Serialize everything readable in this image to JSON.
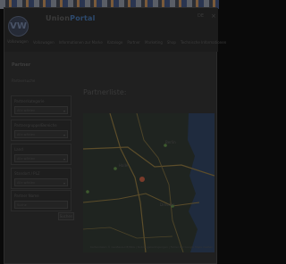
{
  "header": {
    "logo_text": "VW",
    "logo_label": "Volkswagen",
    "portal_name_a": "Union",
    "portal_name_b": "Portal",
    "language": "DE",
    "close_icon": "×"
  },
  "nav": {
    "items": [
      "Volkswagen",
      "Informationen zur Marke",
      "Kataloge",
      "Partner",
      "Marketing",
      "Shop",
      "Technische Informationen"
    ]
  },
  "sidebar": {
    "title": "Partner",
    "subtitle": "Partnersuche",
    "filters": [
      {
        "label": "Partnerkategorie",
        "value": "Alle wählen"
      },
      {
        "label": "Partnergruppe/Bereiche",
        "value": "Alle wählen"
      },
      {
        "label": "Land",
        "value": "Alle wählen"
      },
      {
        "label": "Standort / PLZ",
        "value": "Alle wählen"
      },
      {
        "label": "Partner Name",
        "value": "Suche"
      }
    ],
    "search_button": "Suchen",
    "arrow_icon": "▾"
  },
  "main": {
    "title": "Partnerliste:",
    "map": {
      "cities": [
        "Berlin",
        "Dresden",
        "Halle",
        "Erfurt",
        "Dresden"
      ],
      "caption": "Kartendaten © GeoBasis-DE/BKG | Nutzungsbedingungen | Fehler bei Google Maps melden"
    }
  },
  "colors": {
    "accent": "#2d4a6e",
    "map_land": "#1f2420",
    "map_water": "#1f2b3e",
    "map_road": "#5c4d2a",
    "map_marker": "#7a3b2a"
  }
}
